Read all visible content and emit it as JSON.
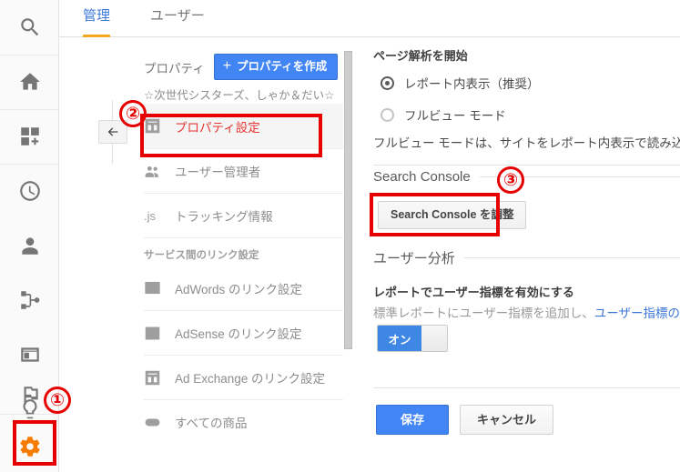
{
  "tabs": [
    {
      "label": "管理",
      "active": true
    },
    {
      "label": "ユーザー",
      "active": false
    }
  ],
  "rail": {
    "items": [
      {
        "name": "search-icon",
        "label": "検索"
      },
      {
        "name": "home-icon",
        "label": "ホーム"
      },
      {
        "name": "customization-icon",
        "label": "カスタム"
      },
      {
        "name": "realtime-clock-icon",
        "label": "リアルタイム"
      },
      {
        "name": "audience-person-icon",
        "label": "ユーザー"
      },
      {
        "name": "acquisition-share-icon",
        "label": "集客"
      },
      {
        "name": "behavior-window-icon",
        "label": "行動"
      },
      {
        "name": "conversions-flag-icon",
        "label": "コンバージョン"
      },
      {
        "name": "discover-bulb-icon",
        "label": "発見"
      },
      {
        "name": "admin-gear-icon",
        "label": "管理"
      }
    ],
    "admin_icon_color": "#f57c00"
  },
  "properties_panel": {
    "header_label": "プロパティ",
    "create_button": "プロパティを作成",
    "create_button_plus": "+",
    "selected_property": "☆次世代シスターズ、しゃか＆だい☆",
    "back_arrow_icon": "back-arrow-icon",
    "menu": [
      {
        "icon": "property-settings-icon",
        "label": "プロパティ設定",
        "selected": true,
        "type": "item"
      },
      {
        "icon": "user-manager-icon",
        "label": "ユーザー管理者",
        "selected": false,
        "type": "item"
      },
      {
        "icon": "js-icon",
        "label": "トラッキング情報",
        "selected": false,
        "type": "js"
      },
      {
        "label": "サービス間のリンク設定",
        "type": "section"
      },
      {
        "icon": "adwords-icon",
        "label": "AdWords のリンク設定",
        "selected": false,
        "type": "item"
      },
      {
        "icon": "adsense-icon",
        "label": "AdSense のリンク設定",
        "selected": false,
        "type": "item"
      },
      {
        "icon": "adexchange-icon",
        "label": "Ad Exchange のリンク設定",
        "selected": false,
        "type": "item"
      },
      {
        "icon": "all-products-icon",
        "label": "すべての商品",
        "selected": false,
        "type": "item"
      }
    ]
  },
  "settings_panel": {
    "page_analytics": {
      "title": "ページ解析を開始",
      "options": [
        {
          "label": "レポート内表示（推奨）",
          "selected": true
        },
        {
          "label": "フルビュー モード",
          "selected": false
        }
      ],
      "helper_text": "フルビュー モードは、サイトをレポート内表示で読み込む"
    },
    "search_console": {
      "section_title": "Search Console",
      "adjust_button": "Search Console を調整"
    },
    "user_analytics": {
      "section_title": "ユーザー分析",
      "enable_title": "レポートでユーザー指標を有効にする",
      "description_prefix": "標準レポートにユーザー指標を追加し、",
      "description_link": "ユーザー指標の計",
      "toggle_state_label": "オン",
      "toggle_on": true
    },
    "actions": {
      "save": "保存",
      "cancel": "キャンセル"
    }
  },
  "annotations": [
    {
      "number": "①",
      "target": "admin-gear-icon"
    },
    {
      "number": "②",
      "target": "property-settings-menu-item"
    },
    {
      "number": "③",
      "target": "search-console-adjust-button"
    }
  ],
  "colors": {
    "accent_blue": "#4285f4",
    "tab_active": "#3c78d8",
    "tab_underline": "#f5a623",
    "annotation_red": "#e60000",
    "selected_text_red": "#e53935",
    "gear_orange": "#f57c00"
  }
}
